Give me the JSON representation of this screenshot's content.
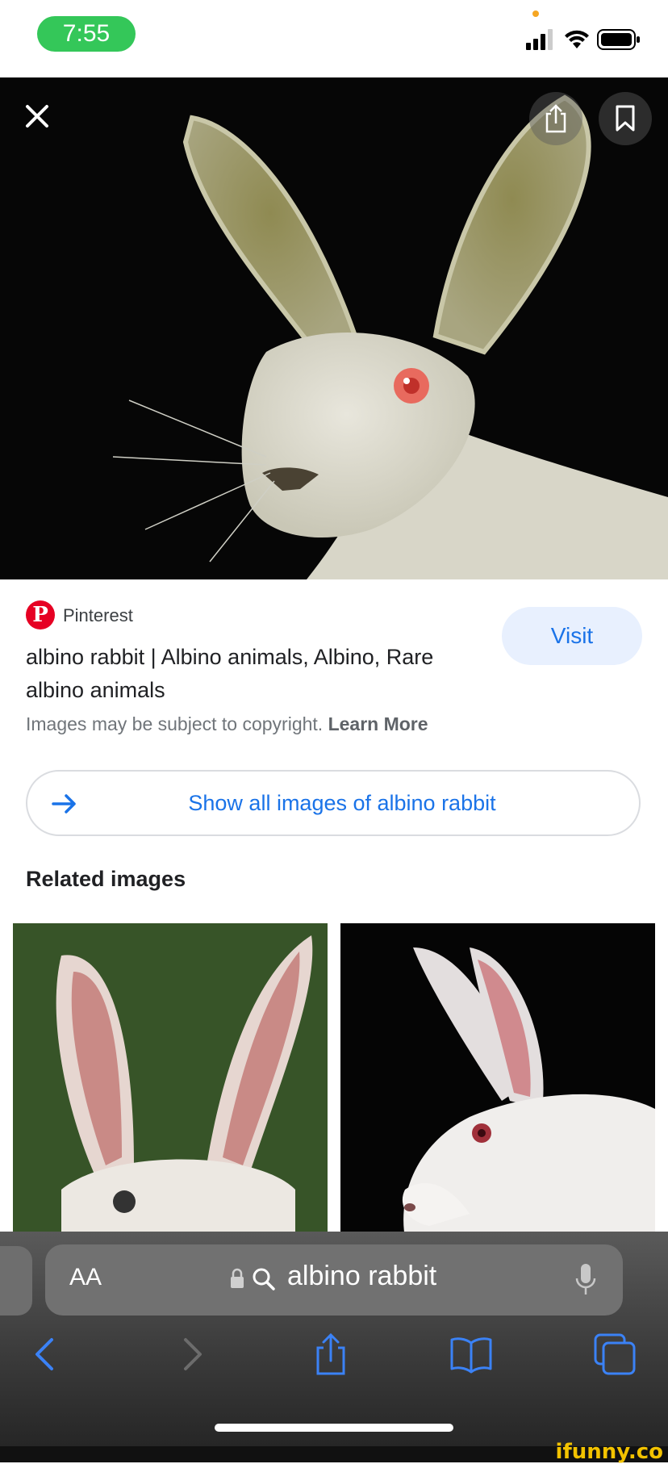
{
  "status_bar": {
    "time": "7:55"
  },
  "result": {
    "source": "Pinterest",
    "title": "albino rabbit | Albino animals, Albino, Rare albino animals",
    "copyright_text": "Images may be subject to copyright.",
    "learn_more": "Learn More",
    "visit_label": "Visit"
  },
  "show_all_label": "Show all images of albino rabbit",
  "related_heading": "Related images",
  "browser": {
    "aa_label": "AA",
    "address_text": "albino rabbit"
  },
  "watermark": "ifunny.co",
  "colors": {
    "accent": "#1a73e8",
    "visit_bg": "#e8f0fe",
    "time_pill": "#34c759",
    "pinterest_red": "#e60023"
  }
}
